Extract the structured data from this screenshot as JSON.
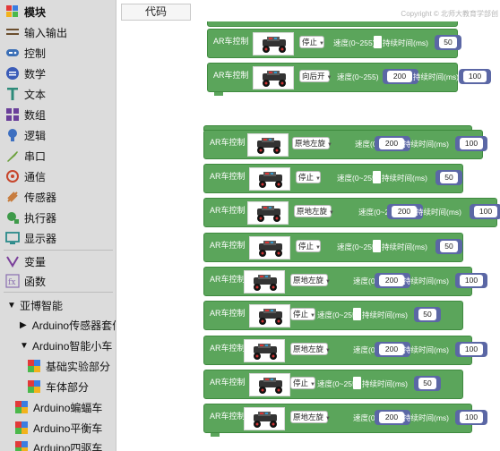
{
  "sidebar": {
    "header": "模块",
    "categories": [
      {
        "label": "输入输出",
        "icon": "io-icon",
        "color": "#6b4e2e"
      },
      {
        "label": "控制",
        "icon": "gamepad-icon",
        "color": "#3b6fb6"
      },
      {
        "label": "数学",
        "icon": "math-icon",
        "color": "#3b5cb8"
      },
      {
        "label": "文本",
        "icon": "text-icon",
        "color": "#2e8b7a"
      },
      {
        "label": "数组",
        "icon": "array-icon",
        "color": "#6a3f9a"
      },
      {
        "label": "逻辑",
        "icon": "logic-icon",
        "color": "#3d6fc0"
      },
      {
        "label": "串口",
        "icon": "serial-icon",
        "color": "#6aa03a"
      },
      {
        "label": "通信",
        "icon": "comm-icon",
        "color": "#c7462c"
      },
      {
        "label": "传感器",
        "icon": "sensor-icon",
        "color": "#c77a3a"
      },
      {
        "label": "执行器",
        "icon": "actuator-icon",
        "color": "#3e9a4a"
      },
      {
        "label": "显示器",
        "icon": "display-icon",
        "color": "#2a8a8a"
      },
      {
        "label": "变量",
        "icon": "variable-icon",
        "color": "#7a3f9a"
      },
      {
        "label": "函数",
        "icon": "function-icon",
        "color": "#8a6fb0"
      }
    ],
    "group": {
      "label": "亚博智能"
    },
    "subitems": [
      {
        "label": "Arduino传感器套件"
      },
      {
        "label": "Arduino智能小车"
      },
      {
        "label": "基础实验部分"
      },
      {
        "label": "车体部分"
      },
      {
        "label": "Arduino蝙蝠车"
      },
      {
        "label": "Arduino平衡车"
      },
      {
        "label": "Arduino四驱车"
      }
    ]
  },
  "tabs": {
    "code_label": "代码"
  },
  "copyright": "Copyright © 北师大教育学部创",
  "blocks": {
    "title": "AR车控制",
    "speed_label": "速度(0~255)",
    "duration_label": "持续时间(ms)",
    "items": [
      {
        "action": "停止",
        "speed": "",
        "duration": "50"
      },
      {
        "action": "向后开",
        "speed": "200",
        "duration": "100"
      },
      {
        "action": "原地左旋",
        "speed": "200",
        "duration": "100"
      },
      {
        "action": "停止",
        "speed": "",
        "duration": "50"
      },
      {
        "action": "原地左旋",
        "speed": "200",
        "duration": "100"
      },
      {
        "action": "停止",
        "speed": "",
        "duration": "50"
      },
      {
        "action": "原地左旋",
        "speed": "200",
        "duration": "100"
      },
      {
        "action": "停止",
        "speed": "",
        "duration": "50"
      },
      {
        "action": "原地左旋",
        "speed": "200",
        "duration": "100"
      },
      {
        "action": "停止",
        "speed": "",
        "duration": "50"
      },
      {
        "action": "原地左旋",
        "speed": "200",
        "duration": "100"
      }
    ]
  }
}
